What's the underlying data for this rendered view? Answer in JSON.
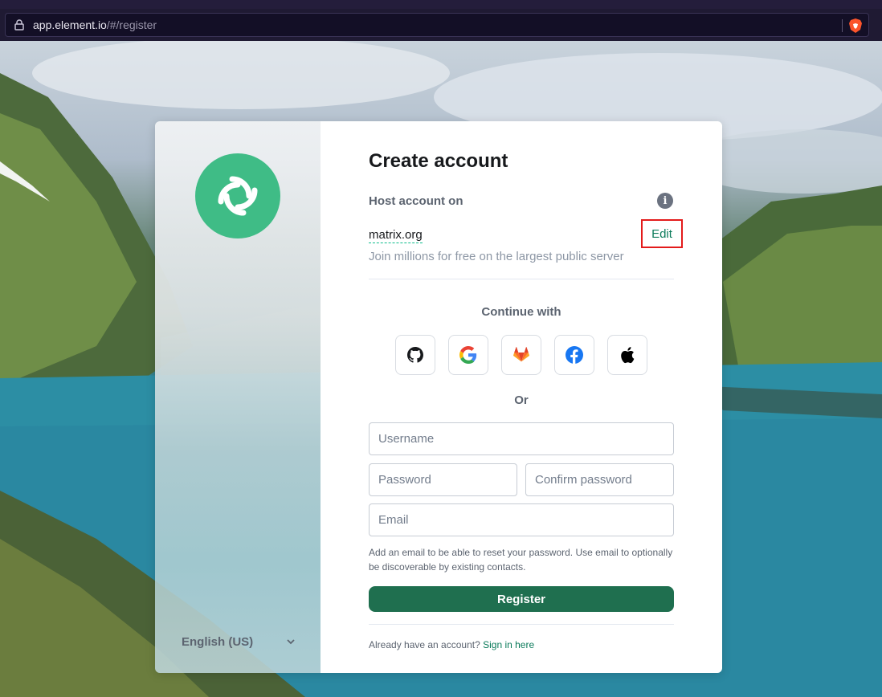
{
  "browser": {
    "url_host": "app.element.io",
    "url_path": "/#/register",
    "lock_icon": "lock-icon",
    "brave_icon": "brave-lion-icon"
  },
  "sidebar": {
    "logo_icon": "element-logo-icon",
    "language_label": "English (US)",
    "language_chevron": "chevron-down-icon"
  },
  "form": {
    "title": "Create account",
    "host_label": "Host account on",
    "info_icon_glyph": "i",
    "server_name": "matrix.org",
    "edit_label": "Edit",
    "server_description": "Join millions for free on the largest public server",
    "continue_with": "Continue with",
    "sso_providers": [
      "github-icon",
      "google-icon",
      "gitlab-icon",
      "facebook-icon",
      "apple-icon"
    ],
    "or_label": "Or",
    "username_placeholder": "Username",
    "password_placeholder": "Password",
    "confirm_password_placeholder": "Confirm password",
    "email_placeholder": "Email",
    "email_help": "Add an email to be able to reset your password. Use email to optionally be discoverable by existing contacts.",
    "register_label": "Register",
    "already_text": "Already have an account?",
    "sign_in_label": "Sign in here"
  },
  "colors": {
    "accent": "#0dbd8b",
    "register_button": "#1f6f4f",
    "logo": "#3fbc86",
    "highlight_box": "#e31b1b"
  }
}
